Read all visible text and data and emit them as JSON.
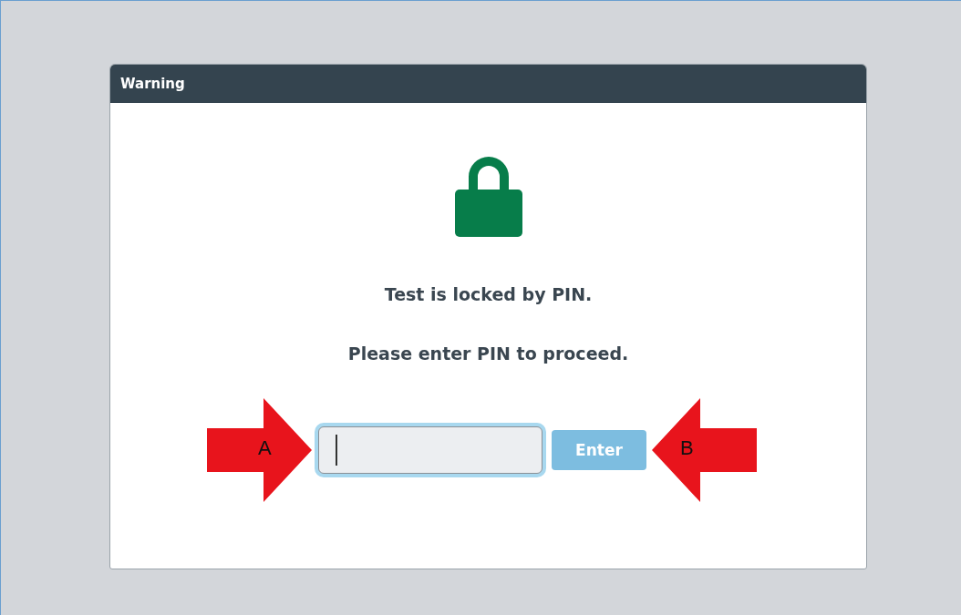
{
  "dialog": {
    "title": "Warning",
    "messages": [
      "Test is locked by PIN.",
      "Please enter PIN to proceed."
    ]
  },
  "pin_field": {
    "focused": true
  },
  "enter_button": {
    "label": "Enter",
    "disabled": true
  },
  "callouts": [
    {
      "label": "A",
      "kind": "right"
    },
    {
      "label": "B",
      "kind": "left"
    }
  ]
}
